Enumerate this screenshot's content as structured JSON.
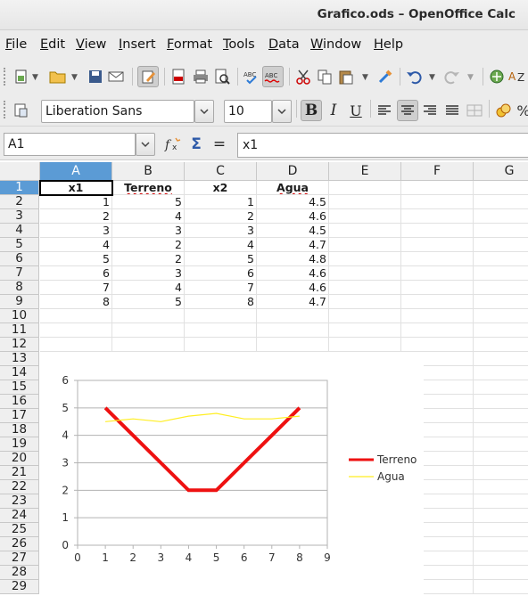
{
  "window": {
    "title": "Grafico.ods – OpenOffice Calc"
  },
  "menu": [
    "File",
    "Edit",
    "View",
    "Insert",
    "Format",
    "Tools",
    "Data",
    "Window",
    "Help"
  ],
  "format_bar": {
    "font_name": "Liberation Sans",
    "font_size": "10"
  },
  "formula_bar": {
    "cell_ref": "A1",
    "content": "x1"
  },
  "columns": [
    "A",
    "B",
    "C",
    "D",
    "E",
    "F",
    "G"
  ],
  "rows": [
    "1",
    "2",
    "3",
    "4",
    "5",
    "6",
    "7",
    "8",
    "9",
    "10",
    "11",
    "12",
    "13",
    "14",
    "15",
    "16",
    "17",
    "18",
    "19",
    "20",
    "21",
    "22",
    "23",
    "24",
    "25",
    "26",
    "27",
    "28",
    "29"
  ],
  "sheet": {
    "headers": [
      "x1",
      "Terreno",
      "x2",
      "Agua"
    ],
    "data": [
      [
        "1",
        "5",
        "1",
        "4.5"
      ],
      [
        "2",
        "4",
        "2",
        "4.6"
      ],
      [
        "3",
        "3",
        "3",
        "4.5"
      ],
      [
        "4",
        "2",
        "4",
        "4.7"
      ],
      [
        "5",
        "2",
        "5",
        "4.8"
      ],
      [
        "6",
        "3",
        "6",
        "4.6"
      ],
      [
        "7",
        "4",
        "7",
        "4.6"
      ],
      [
        "8",
        "5",
        "8",
        "4.7"
      ]
    ]
  },
  "chart_data": {
    "type": "line",
    "xlim": [
      0,
      9
    ],
    "ylim": [
      0,
      6
    ],
    "x_ticks": [
      "0",
      "1",
      "2",
      "3",
      "4",
      "5",
      "6",
      "7",
      "8",
      "9"
    ],
    "y_ticks": [
      "0",
      "1",
      "2",
      "3",
      "4",
      "5",
      "6"
    ],
    "grid": true,
    "legend_position": "right",
    "series": [
      {
        "name": "Terreno",
        "color": "#ee1111",
        "x": [
          1,
          2,
          3,
          4,
          5,
          6,
          7,
          8
        ],
        "values": [
          5,
          4,
          3,
          2,
          2,
          3,
          4,
          5
        ]
      },
      {
        "name": "Agua",
        "color": "#ffee22",
        "x": [
          1,
          2,
          3,
          4,
          5,
          6,
          7,
          8
        ],
        "values": [
          4.5,
          4.6,
          4.5,
          4.7,
          4.8,
          4.6,
          4.6,
          4.7
        ]
      }
    ]
  }
}
